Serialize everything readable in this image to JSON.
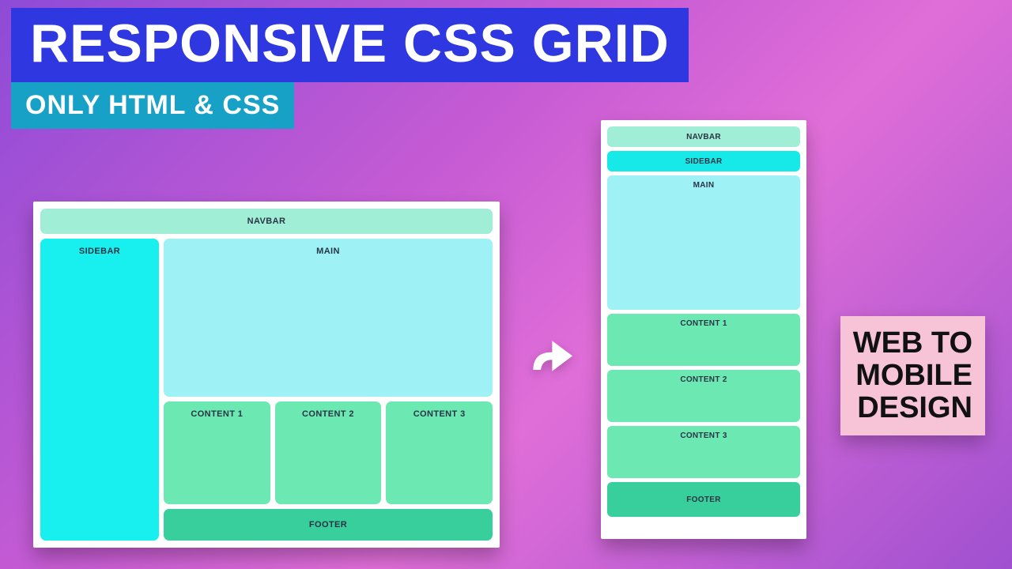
{
  "headline": "RESPONSIVE CSS GRID",
  "subhead": "ONLY HTML & CSS",
  "callout": {
    "l1": "WEB TO",
    "l2": "MOBILE",
    "l3": "DESIGN"
  },
  "colors": {
    "banner_blue": "#2f38e0",
    "banner_teal": "#18a1c7",
    "callout_pink": "#f7c4d7",
    "cell_navbar": "#a1eed6",
    "cell_sidebar": "#17f0ee",
    "cell_main": "#9ef1f4",
    "cell_content": "#6ce8b2",
    "cell_footer": "#38cf9c"
  },
  "desktop": {
    "navbar": "NAVBAR",
    "sidebar": "SIDEBAR",
    "main": "MAIN",
    "content1": "CONTENT 1",
    "content2": "CONTENT 2",
    "content3": "CONTENT 3",
    "footer": "FOOTER"
  },
  "mobile": {
    "navbar": "NAVBAR",
    "sidebar": "SIDEBAR",
    "main": "MAIN",
    "content1": "CONTENT 1",
    "content2": "CONTENT 2",
    "content3": "CONTENT 3",
    "footer": "FOOTER"
  }
}
